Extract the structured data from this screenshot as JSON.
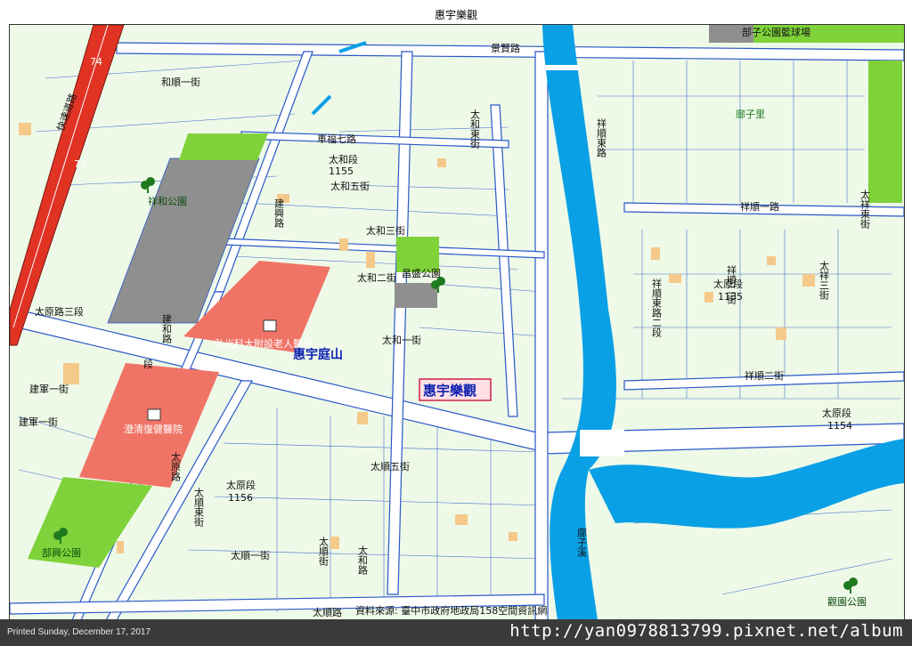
{
  "title": "惠宇樂觀",
  "printed": "Printed Sunday, December 17, 2017",
  "watermark": "http://yan0978813799.pixnet.net/album",
  "source": "資料來源: 臺中市政府地政局158空間資訊網",
  "colors": {
    "background": "#eef9e8",
    "road": "#ffffff",
    "road_edge": "#2a58c8",
    "river": "#0aa0e6",
    "park": "#7fd23a",
    "school": "#f07466",
    "gray_block": "#8f8f8f",
    "building": "#f5c98a",
    "highway": "#e03324"
  },
  "labels": {
    "highway": "74",
    "highway2": "74",
    "highway_name": "快速道路",
    "jingxian_road": "景賢路",
    "heshun_1": "和順一街",
    "chengqi_10": "車福七路",
    "taihe_east": "太和東街",
    "taihe_district_1155": "太和段",
    "num_1155": "1155",
    "taihe_5": "太和五街",
    "xianghe_park": "祥和公園",
    "jianxing_road": "建興路",
    "taihe_3": "太和三街",
    "taihe_2": "太和二街",
    "changsheng_park": "昌盛公園",
    "taiyuan_3": "太原路三段",
    "jianhe_road": "建和路",
    "school_name": "弘光科大附設老人醫院",
    "project_left": "惠宇庭山",
    "project_main": "惠宇樂觀",
    "taihe_1": "太和一街",
    "jianjun_1": "建軍一街",
    "jianjun_2": "建軍一街",
    "duan_char": "段",
    "hospital": "澄清復健醫院",
    "taiyuan_road": "太原路",
    "taishun_5": "太順五街",
    "taiyuan_district_1156": "太原段",
    "num_1156": "1156",
    "taishun_east": "太順東街",
    "buzi_park": "部興公園",
    "taishun_1": "太順一街",
    "taishun_street": "太順街",
    "taihe_road": "太和路",
    "taishun_road": "太順路",
    "buzi_park_top": "部子公園籃球場",
    "xiangshun_east_road": "祥順東路",
    "buzi_li": "廍子里",
    "xiangshun_road": "祥順一路",
    "taixiang_east": "太祥東街",
    "taiyuan_district_1135": "太原段",
    "num_1135": "1135",
    "taixiang_3": "太祥三街",
    "xiangshun_east_2": "祥順東路二段",
    "xiangshun_2": "祥順二街",
    "xiangshun_street": "祥順二街",
    "taiyuan_district_1154": "太原段",
    "num_1154": "1154",
    "buzi_stream": "廍子溪",
    "right_park": "觀園公園"
  }
}
